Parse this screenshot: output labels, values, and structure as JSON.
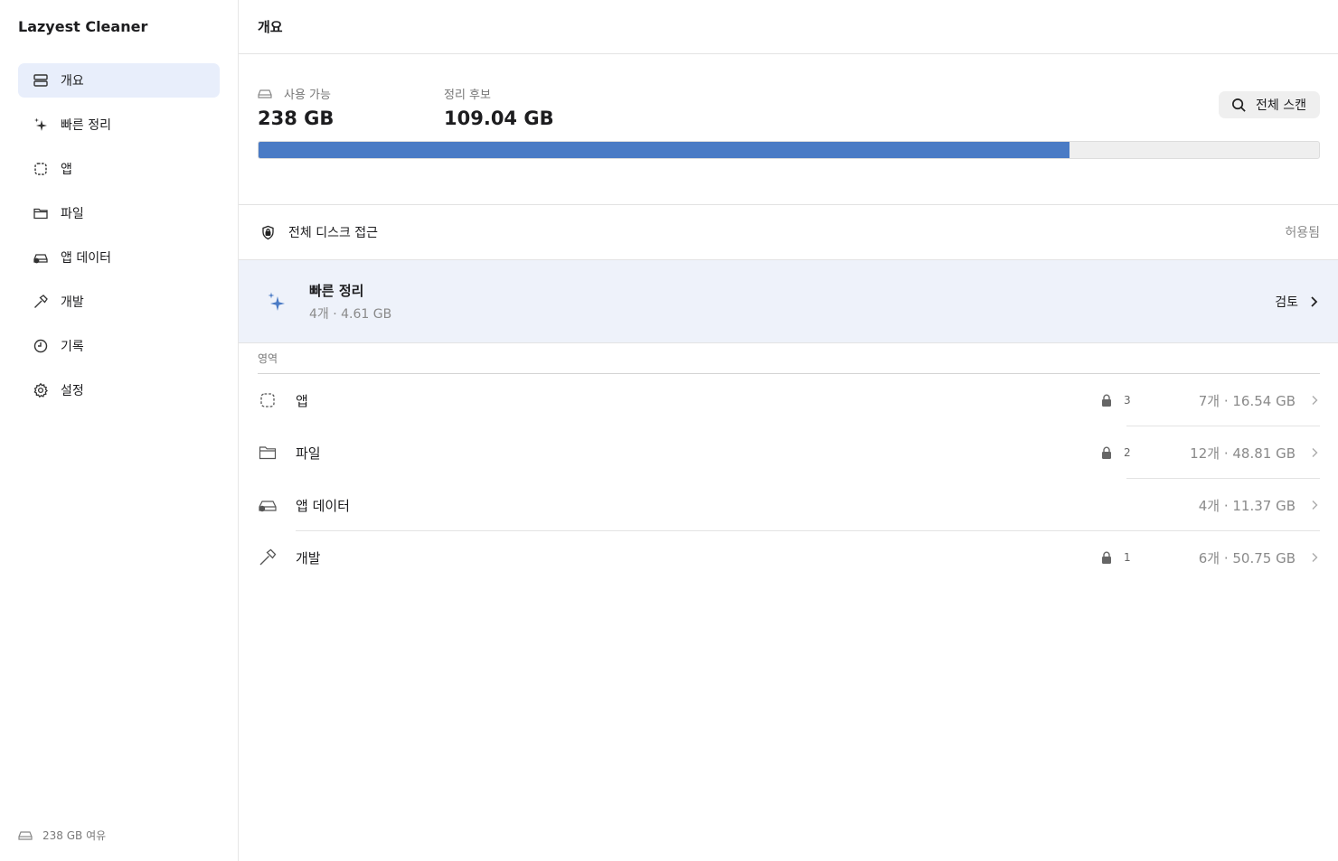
{
  "sidebar": {
    "app_title": "Lazyest Cleaner",
    "items": [
      {
        "label": "개요",
        "icon": "overview-icon",
        "active": true
      },
      {
        "label": "빠른 정리",
        "icon": "sparkle-icon"
      },
      {
        "label": "앱",
        "icon": "app-icon"
      },
      {
        "label": "파일",
        "icon": "folder-icon"
      },
      {
        "label": "앱 데이터",
        "icon": "app-data-icon"
      },
      {
        "label": "개발",
        "icon": "hammer-icon"
      },
      {
        "label": "기록",
        "icon": "clock-icon"
      },
      {
        "label": "설정",
        "icon": "gear-icon"
      }
    ],
    "footer": "238 GB 여유"
  },
  "main": {
    "title": "개요",
    "stats": {
      "available_label": "사용 가능",
      "available_value": "238 GB",
      "candidate_label": "정리 후보",
      "candidate_value": "109.04 GB",
      "usage_fraction": 0.765
    },
    "scan_button": "전체 스캔",
    "disk_access": {
      "title": "전체 디스크 접근",
      "status": "허용됨"
    },
    "quick_clean": {
      "title": "빠른 정리",
      "subtitle": "4개 · 4.61 GB",
      "action": "검토"
    },
    "section_label": "영역",
    "areas": [
      {
        "name": "앱",
        "icon": "app-icon",
        "locked": true,
        "lock_count": "3",
        "size": "7개 · 16.54 GB"
      },
      {
        "name": "파일",
        "icon": "folder-icon",
        "locked": true,
        "lock_count": "2",
        "size": "12개 · 48.81 GB"
      },
      {
        "name": "앱 데이터",
        "icon": "app-data-icon",
        "locked": false,
        "lock_count": "",
        "size": "4개 · 11.37 GB"
      },
      {
        "name": "개발",
        "icon": "hammer-icon",
        "locked": true,
        "lock_count": "1",
        "size": "6개 · 50.75 GB"
      }
    ]
  },
  "colors": {
    "accent": "#4a7bc5",
    "active_nav_bg": "#e8eefb",
    "quick_row_bg": "#eef2fa"
  }
}
